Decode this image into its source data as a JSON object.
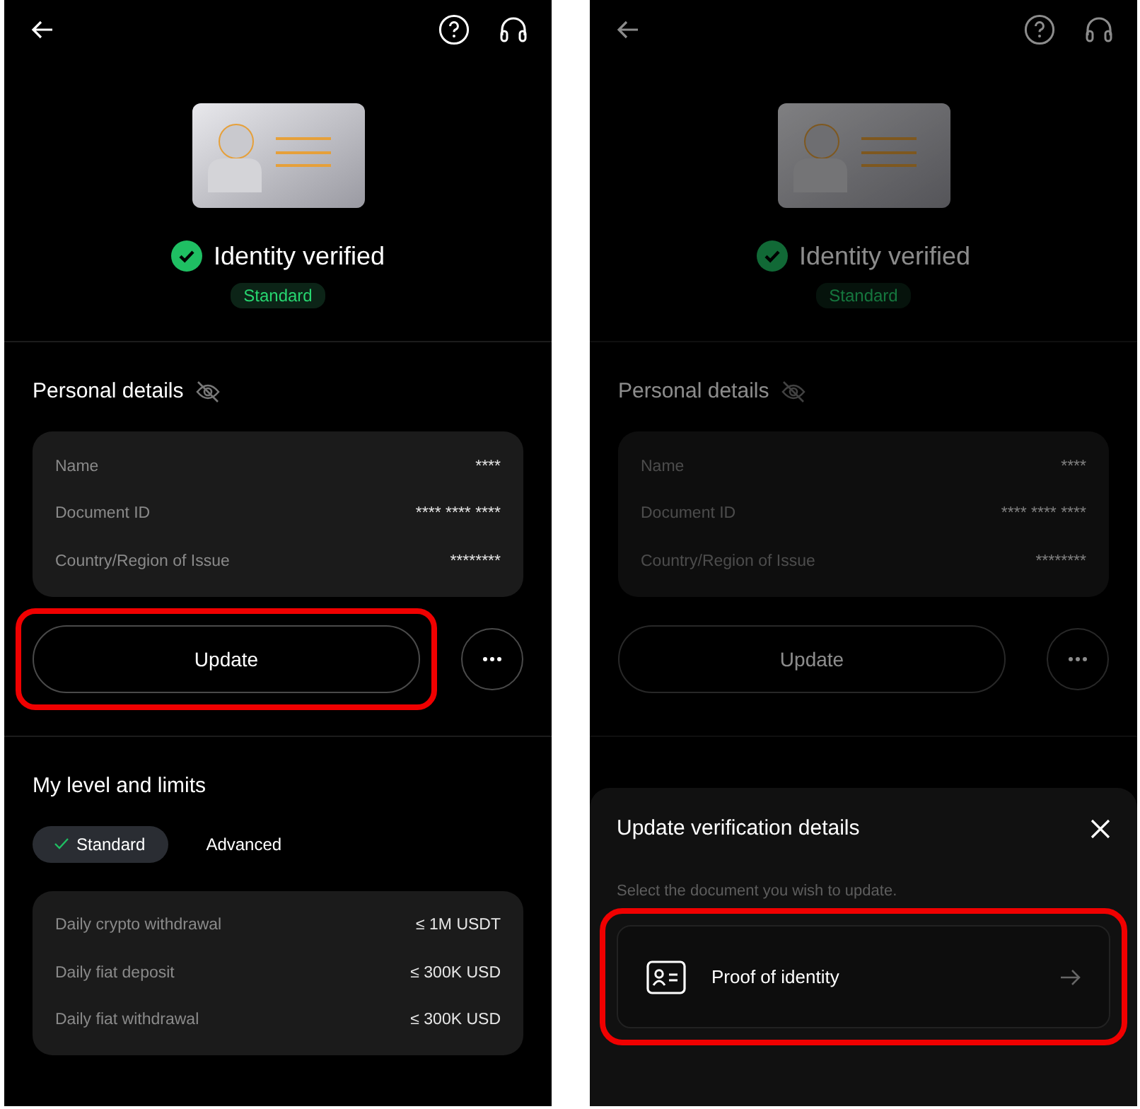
{
  "screens": [
    {
      "dimmed": false,
      "status": {
        "title": "Identity verified",
        "badge": "Standard"
      },
      "personal_details": {
        "title": "Personal details",
        "fields": [
          {
            "label": "Name",
            "value": "****"
          },
          {
            "label": "Document ID",
            "value": "**** **** ****"
          },
          {
            "label": "Country/Region of Issue",
            "value": "********"
          }
        ]
      },
      "update_button": {
        "label": "Update",
        "highlighted": true
      },
      "levels": {
        "title": "My level and limits",
        "tabs": [
          {
            "label": "Standard",
            "selected": true
          },
          {
            "label": "Advanced",
            "selected": false
          }
        ],
        "limits": [
          {
            "label": "Daily crypto withdrawal",
            "value": "≤ 1M USDT"
          },
          {
            "label": "Daily fiat deposit",
            "value": "≤ 300K USD"
          },
          {
            "label": "Daily fiat withdrawal",
            "value": "≤ 300K USD"
          }
        ]
      }
    },
    {
      "dimmed": true,
      "status": {
        "title": "Identity verified",
        "badge": "Standard"
      },
      "personal_details": {
        "title": "Personal details",
        "fields": [
          {
            "label": "Name",
            "value": "****"
          },
          {
            "label": "Document ID",
            "value": "**** **** ****"
          },
          {
            "label": "Country/Region of Issue",
            "value": "********"
          }
        ]
      },
      "update_button": {
        "label": "Update",
        "highlighted": false
      },
      "sheet": {
        "title": "Update verification details",
        "hint": "Select the document you wish to update.",
        "options": [
          {
            "label": "Proof of identity",
            "highlighted": true
          }
        ]
      }
    }
  ]
}
